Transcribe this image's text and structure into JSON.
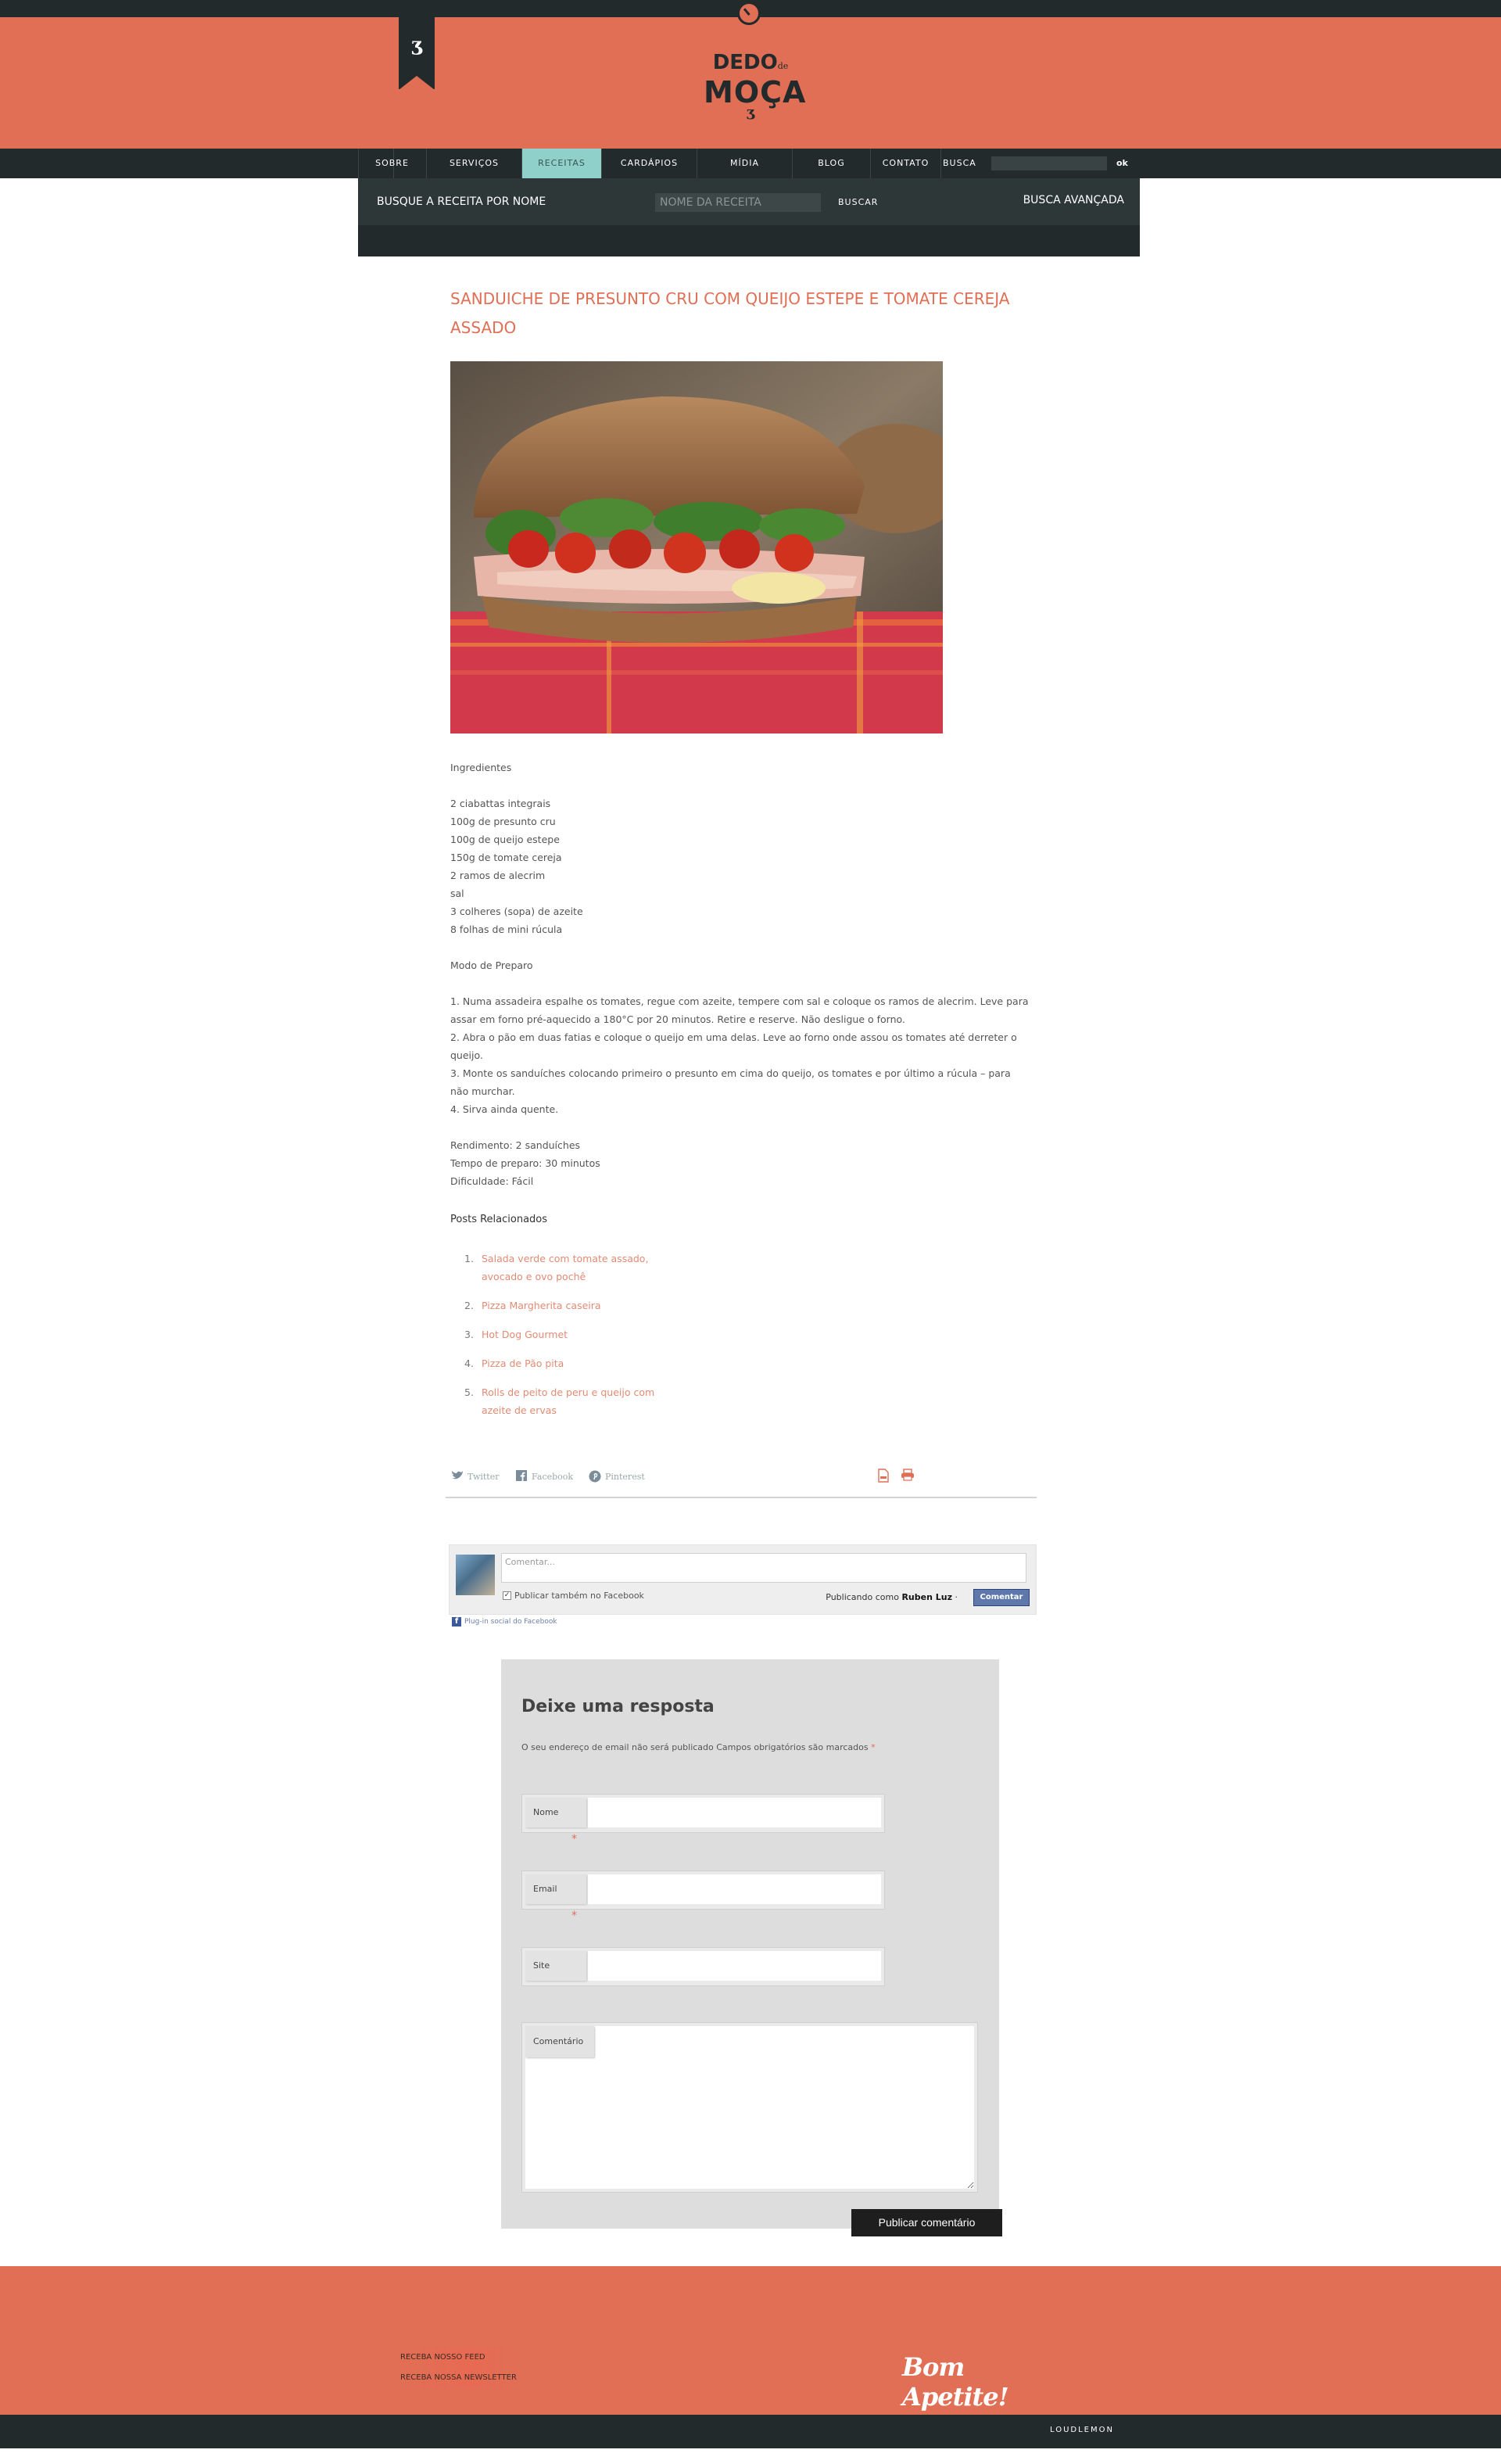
{
  "colors": {
    "brand": "#e06f55",
    "dark": "#222a2b",
    "nav_active": "#8fd0cb",
    "link": "#e28b74"
  },
  "header": {
    "ribbon_glyph": "ʒ",
    "logo": {
      "line1": "DEDO",
      "line1_small": "de",
      "line2": "MOÇA",
      "mark": "ʒ"
    }
  },
  "nav": {
    "items": [
      {
        "label": "SOBRE"
      },
      {
        "label": "SERVIÇOS"
      },
      {
        "label": "RECEITAS",
        "active": true
      },
      {
        "label": "CARDÁPIOS"
      },
      {
        "label": "MÍDIA"
      },
      {
        "label": "BLOG"
      },
      {
        "label": "CONTATO"
      }
    ],
    "search_label": "BUSCA",
    "ok_label": "ok"
  },
  "recipe_search": {
    "label": "BUSQUE A RECEITA POR NOME",
    "placeholder": "NOME DA RECEITA",
    "button": "BUSCAR",
    "advanced": "BUSCA AVANÇADA"
  },
  "post": {
    "title": "SANDUICHE DE PRESUNTO CRU COM QUEIJO ESTEPE E TOMATE CEREJA ASSADO",
    "ingredients_heading": "Ingredientes",
    "ingredients": [
      "2 ciabattas integrais",
      "100g de presunto cru",
      "100g de queijo estepe",
      "150g de tomate cereja",
      "2 ramos de alecrim",
      "sal",
      "3 colheres (sopa) de azeite",
      "8 folhas de mini rúcula"
    ],
    "method_heading": "Modo de Preparo",
    "steps": [
      "1. Numa assadeira espalhe os tomates, regue com azeite, tempere com sal e coloque os ramos de alecrim. Leve para assar em forno pré-aquecido a 180°C por 20 minutos. Retire e reserve. Não desligue o forno.",
      "2. Abra o pão em duas fatias e coloque o queijo em uma delas. Leve ao forno onde assou os tomates até derreter o queijo.",
      "3. Monte os sanduíches colocando primeiro o presunto em cima do queijo, os tomates e por último a rúcula – para não murchar.",
      "4. Sirva ainda quente."
    ],
    "yield": "Rendimento: 2 sanduíches",
    "prep_time": "Tempo de preparo: 30 minutos",
    "difficulty": "Dificuldade: Fácil"
  },
  "related": {
    "heading": "Posts Relacionados",
    "items": [
      {
        "num": "1.",
        "label": "Salada verde com tomate assado, avocado e ovo pochê"
      },
      {
        "num": "2.",
        "label": "Pizza Margherita caseira"
      },
      {
        "num": "3.",
        "label": "Hot Dog Gourmet"
      },
      {
        "num": "4.",
        "label": "Pizza de Pão pita"
      },
      {
        "num": "5.",
        "label": "Rolls de peito de peru e queijo com azeite de ervas"
      }
    ]
  },
  "share": {
    "twitter": "Twitter",
    "facebook": "Facebook",
    "pinterest": "Pinterest"
  },
  "facebook_comments": {
    "placeholder": "Comentar...",
    "also_post": "Publicar também no Facebook",
    "posting_as_prefix": "Publicando como",
    "posting_as_name": "Ruben Luz",
    "posting_as_suffix": " ·",
    "button": "Comentar",
    "plugin_label": "Plug-in social do Facebook"
  },
  "reply": {
    "heading": "Deixe uma resposta",
    "notes": "O seu endereço de email não será publicado Campos obrigatórios são marcados",
    "required_mark": "*",
    "name_label": "Nome",
    "email_label": "Email",
    "site_label": "Site",
    "comment_label": "Comentário",
    "submit": "Publicar comentário"
  },
  "footer": {
    "feed": "RECEBA NOSSO FEED",
    "newsletter": "RECEBA NOSSA NEWSLETTER",
    "tagline": "Bom Apetite!",
    "credit": "LOUDLEMON"
  }
}
